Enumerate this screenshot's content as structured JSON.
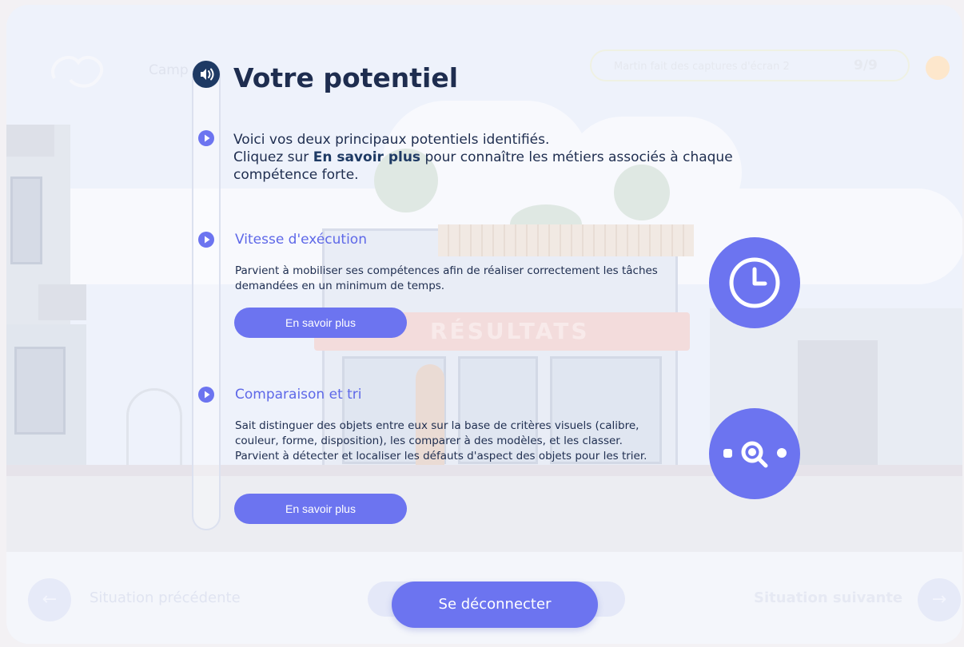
{
  "header": {
    "campaign_text": "Camp",
    "user_name": "Martin fait des captures d'écran 2",
    "user_count": "9/9"
  },
  "main": {
    "title": "Votre potentiel",
    "intro_line1": "Voici vos deux principaux potentiels identifiés.",
    "intro_line2_prefix": "Cliquez sur ",
    "intro_line2_bold": "En savoir plus",
    "intro_line2_suffix": " pour connaître les métiers associés à chaque compétence forte.",
    "skills": [
      {
        "title": "Vitesse d'exécution",
        "description": "Parvient à mobiliser ses compétences afin de réaliser correctement les tâches demandées en un minimum de temps.",
        "button_label": "En savoir plus",
        "icon": "clock-icon"
      },
      {
        "title": "Comparaison et tri",
        "description": "Sait distinguer des objets entre eux sur la base de critères visuels (calibre, couleur, forme, disposition), les comparer à des modèles, et les classer. Parvient à détecter et localiser les défauts d'aspect des objets pour les trier.",
        "button_label": "En savoir plus",
        "icon": "magnifier-icon"
      }
    ]
  },
  "scene": {
    "shop_sign": "RÉSULTATS"
  },
  "footer": {
    "prev_label": "Situation précédente",
    "next_label": "Situation suivante",
    "logout_label": "Se déconnecter"
  },
  "colors": {
    "accent": "#6c74f0",
    "title": "#1e2d4f",
    "speaker": "#1e3a64"
  }
}
